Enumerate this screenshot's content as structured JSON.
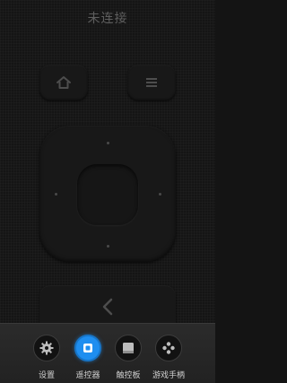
{
  "header": {
    "title": "未连接"
  },
  "remote": {
    "home_icon": "home-icon",
    "menu_icon": "menu-icon",
    "back_icon": "back-chevron-icon"
  },
  "bottom_nav": {
    "active_color": "#1e8ef0",
    "tabs": [
      {
        "label": "设置",
        "icon": "gear-icon",
        "active": false
      },
      {
        "label": "遥控器",
        "icon": "remote-icon",
        "active": true
      },
      {
        "label": "触控板",
        "icon": "touchpad-icon",
        "active": false
      },
      {
        "label": "游戏手柄",
        "icon": "gamepad-icon",
        "active": false
      }
    ]
  }
}
